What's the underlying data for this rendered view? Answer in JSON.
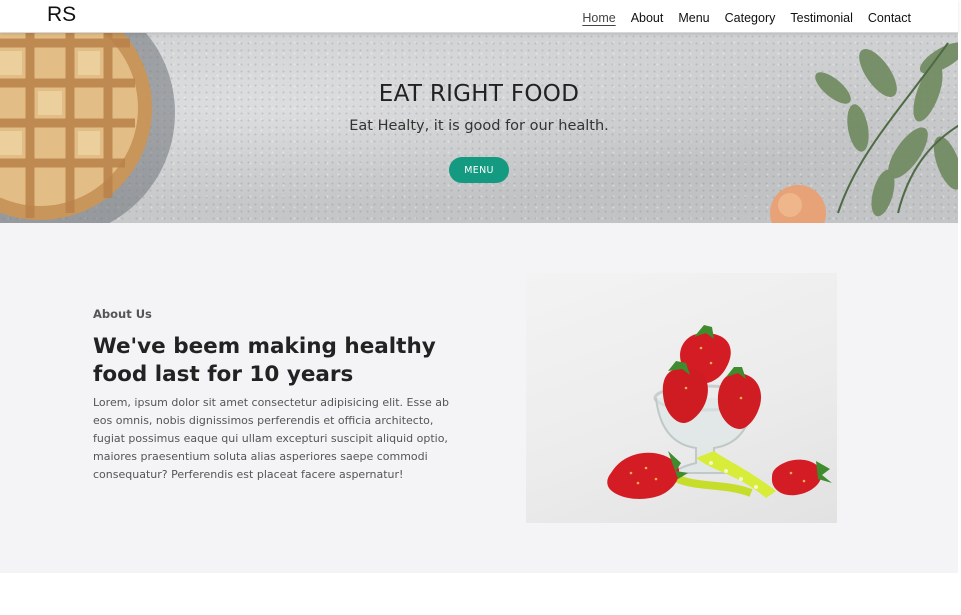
{
  "navbar": {
    "brand": "RS",
    "links": [
      {
        "label": "Home",
        "active": true
      },
      {
        "label": "About"
      },
      {
        "label": "Menu"
      },
      {
        "label": "Category"
      },
      {
        "label": "Testimonial"
      },
      {
        "label": "Contact"
      }
    ]
  },
  "hero": {
    "title": "EAT RIGHT FOOD",
    "subtitle": "Eat Healty, it is good for our health.",
    "button_label": "MENU",
    "button_color": "#149a80"
  },
  "about": {
    "label": "About Us",
    "heading": "We've beem making healthy food last for 10 years",
    "body": "Lorem, ipsum dolor sit amet consectetur adipisicing elit. Esse ab eos omnis, nobis dignissimos perferendis et officia architecto, fugiat possimus eaque qui ullam excepturi suscipit aliquid optio, maiores praesentium soluta alias asperiores saepe commodi consequatur? Perferendis est placeat facere aspernatur!"
  }
}
